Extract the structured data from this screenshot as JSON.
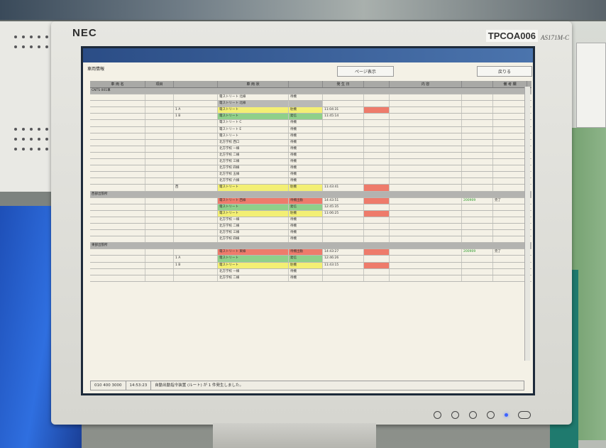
{
  "monitor": {
    "brand": "NEC",
    "model": "TPCOA006",
    "series": "AS171M-C"
  },
  "app": {
    "window_title": "車両情報",
    "print_button": "ページ表示",
    "back_button": "戻りる",
    "columns": [
      "車 両 名",
      "項目",
      "",
      "車 両 状",
      "",
      "発 生 日",
      "",
      "内 容",
      "",
      "備 考 欄"
    ],
    "sections": [
      {
        "title": "CNTS 001車",
        "rows": [
          {
            "name": "電ストリート 北線",
            "status": "待機",
            "color": "",
            "time": "",
            "alert": ""
          },
          {
            "name": "電ストリート 北線",
            "status": "",
            "color": "gray",
            "time": "",
            "alert": ""
          },
          {
            "c2": "1 A",
            "name": "電ストリート",
            "status": "駐機",
            "color": "yellow",
            "time": "11:04:31",
            "alert": "red"
          },
          {
            "c2": "1 B",
            "name": "電ストリート",
            "status": "発信",
            "color": "green",
            "time": "11:45:14",
            "alert": ""
          },
          {
            "name": "電ストリート C",
            "status": "待機",
            "color": "",
            "time": "",
            "alert": ""
          },
          {
            "name": "電ストリート E",
            "status": "待機",
            "color": "",
            "time": "",
            "alert": ""
          },
          {
            "name": "電ストリート",
            "status": "待機",
            "color": "",
            "time": "",
            "alert": ""
          },
          {
            "name": "北方学校 西口",
            "status": "待機",
            "color": "",
            "time": "",
            "alert": ""
          },
          {
            "name": "北方学校 一線",
            "status": "待機",
            "color": "",
            "time": "",
            "alert": ""
          },
          {
            "name": "北方学校 二線",
            "status": "待機",
            "color": "",
            "time": "",
            "alert": ""
          },
          {
            "name": "北方学校 三線",
            "status": "待機",
            "color": "",
            "time": "",
            "alert": ""
          },
          {
            "name": "北方学校 四線",
            "status": "待機",
            "color": "",
            "time": "",
            "alert": ""
          },
          {
            "name": "北方学校 五線",
            "status": "待機",
            "color": "",
            "time": "",
            "alert": ""
          },
          {
            "name": "北方学校 六線",
            "status": "待機",
            "color": "",
            "time": "",
            "alert": ""
          },
          {
            "c2": "西",
            "name": "電ストリート",
            "status": "駐機",
            "color": "yellow",
            "time": "11:43:41",
            "alert": "red"
          }
        ]
      },
      {
        "title": "西部出張所",
        "rows": [
          {
            "name": "電ストリート 西線",
            "status": "待機出動",
            "color": "red",
            "time": "14:43:51",
            "alert": "red",
            "note1": "200909",
            "note2": "完了"
          },
          {
            "name": "電ストリート",
            "status": "発信",
            "color": "green",
            "time": "12:45:35",
            "alert": ""
          },
          {
            "name": "電ストリート",
            "status": "駐機",
            "color": "yellow",
            "time": "11:06:25",
            "alert": "red"
          },
          {
            "name": "北方学校 一線",
            "status": "待機",
            "color": "",
            "time": "",
            "alert": ""
          },
          {
            "name": "北方学校 二線",
            "status": "待機",
            "color": "",
            "time": "",
            "alert": ""
          },
          {
            "name": "北方学校 三線",
            "status": "待機",
            "color": "",
            "time": "",
            "alert": ""
          },
          {
            "name": "北方学校 四線",
            "status": "待機",
            "color": "",
            "time": "",
            "alert": ""
          }
        ]
      },
      {
        "title": "東部出張所",
        "rows": [
          {
            "name": "電ストリート 東線",
            "status": "待機出動",
            "color": "red",
            "time": "14:43:27",
            "alert": "red",
            "note1": "200909",
            "note2": "完了"
          },
          {
            "c2": "1 A",
            "name": "電ストリート",
            "status": "発信",
            "color": "green",
            "time": "12:46:26",
            "alert": ""
          },
          {
            "c2": "1 B",
            "name": "電ストリート",
            "status": "駐機",
            "color": "yellow",
            "time": "11:43:15",
            "alert": "red"
          },
          {
            "name": "北方学校 一線",
            "status": "待機",
            "color": "",
            "time": "",
            "alert": ""
          },
          {
            "name": "北方学校 二線",
            "status": "待機",
            "color": "",
            "time": "",
            "alert": ""
          }
        ]
      }
    ],
    "status_bar": {
      "left": "010 400 3000",
      "time": "14:53:23",
      "message": "自動出動指令装置 (ルート) が 1 件発生しました。"
    }
  }
}
